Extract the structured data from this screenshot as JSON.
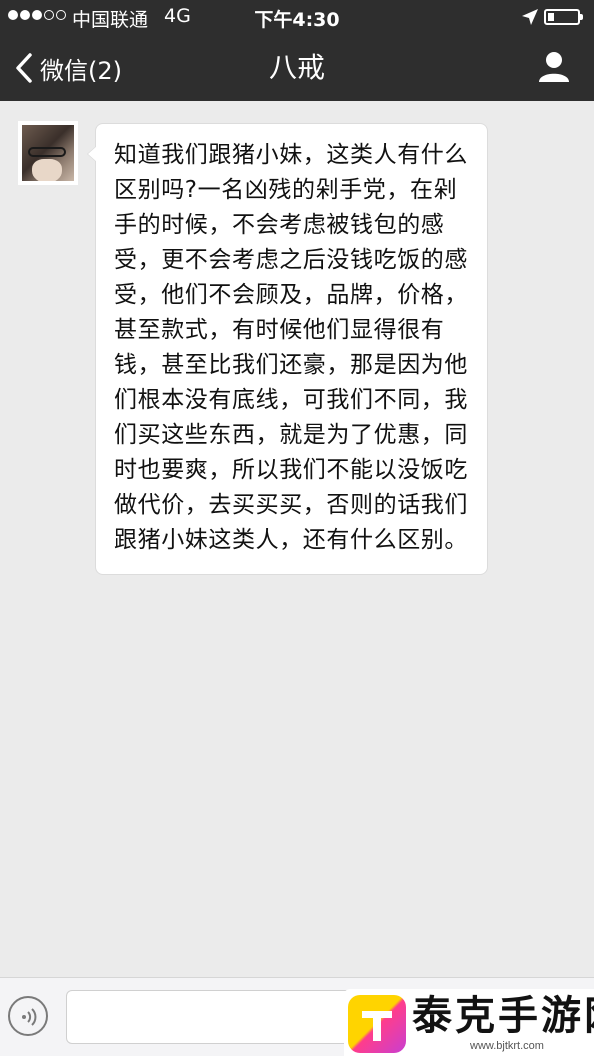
{
  "status_bar": {
    "carrier": "中国联通",
    "network": "4G",
    "time": "下午4:30",
    "signal_strength": 3,
    "signal_max": 5,
    "battery_level": 0.2
  },
  "nav": {
    "back_label": "微信(2)",
    "title": "八戒",
    "back_icon": "chevron-left-icon",
    "profile_icon": "person-icon"
  },
  "messages": [
    {
      "sender": "other",
      "text": "知道我们跟猪小妹，这类人有什么区别吗?一名凶残的剁手党，在剁手的时候，不会考虑被钱包的感受，更不会考虑之后没钱吃饭的感受，他们不会顾及，品牌，价格，甚至款式，有时候他们显得很有钱，甚至比我们还豪，那是因为他们根本没有底线，可我们不同，我们买这些东西，就是为了优惠，同时也要爽，所以我们不能以没饭吃做代价，去买买买，否则的话我们跟猪小妹这类人，还有什么区别。"
    }
  ],
  "input_bar": {
    "voice_icon": "voice-icon",
    "text_value": ""
  },
  "watermark": {
    "name": "泰克手游网",
    "url": "www.bjtkrt.com"
  },
  "colors": {
    "header_bg": "#2e2e2e",
    "chat_bg": "#ebebeb",
    "bubble_bg": "#ffffff"
  }
}
